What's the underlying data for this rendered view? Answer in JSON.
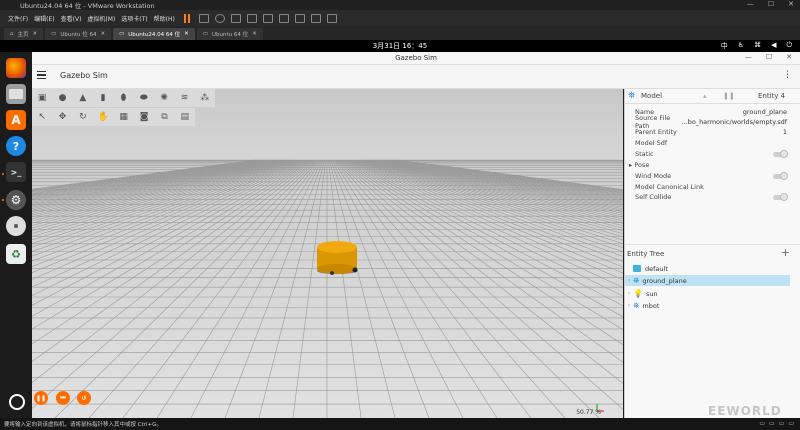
{
  "vmware": {
    "window_title": "Ubuntu24.04 64 位 - VMware Workstation",
    "menu": [
      "文件(F)",
      "编辑(E)",
      "查看(V)",
      "虚拟机(M)",
      "选项卡(T)",
      "帮助(H)"
    ],
    "tabs": [
      {
        "label": "主页",
        "active": false
      },
      {
        "label": "Ubuntu 位 64",
        "active": false
      },
      {
        "label": "Ubuntu24.04 64 位",
        "active": true
      },
      {
        "label": "Ubuntu 64 位",
        "active": false
      }
    ],
    "status_message": "要将输入定向到该虚拟机，请将鼠标指针移入其中或按 Ctrl+G。"
  },
  "ubuntu": {
    "clock": "3月31日  16：45",
    "input_method": "中",
    "dock_apps": [
      "firefox-icon",
      "files-icon",
      "app-center-icon",
      "help-icon",
      "terminal-icon",
      "settings-icon",
      "disc-icon",
      "trash-icon",
      "ubuntu-logo-icon"
    ]
  },
  "gazebo": {
    "window_title": "Gazebo Sim",
    "app_title": "Gazebo Sim",
    "real_time_factor": "50.77 %",
    "top_toolbar": [
      "box-icon",
      "sphere-icon",
      "cone-icon",
      "cylinder-icon",
      "capsule-icon",
      "ellipsoid-icon",
      "sun-icon",
      "lines-icon",
      "spotlight-icon"
    ],
    "second_toolbar": [
      "select-icon",
      "translate-icon",
      "rotate-icon",
      "grab-icon",
      "grid-icon",
      "camera-icon",
      "copy-icon",
      "paste-icon"
    ],
    "component_inspector": {
      "type": "Model",
      "entity": "Entity 4",
      "name_label": "Name",
      "name_value": "ground_plane",
      "source_label": "Source File Path",
      "source_value": "...bo_harmonic/worlds/empty.sdf",
      "parent_label": "Parent Entity",
      "parent_value": "1",
      "model_sdf_label": "Model Sdf",
      "static_label": "Static",
      "pose_label": "Pose",
      "wind_label": "Wind Mode",
      "canonical_label": "Model Canonical Link",
      "self_collide_label": "Self Collide"
    },
    "entity_tree": {
      "title": "Entity Tree",
      "add": "+",
      "items": [
        "default",
        "ground_plane",
        "sun",
        "mbot"
      ],
      "selected": "ground_plane"
    }
  },
  "watermark": "EEWORLD"
}
